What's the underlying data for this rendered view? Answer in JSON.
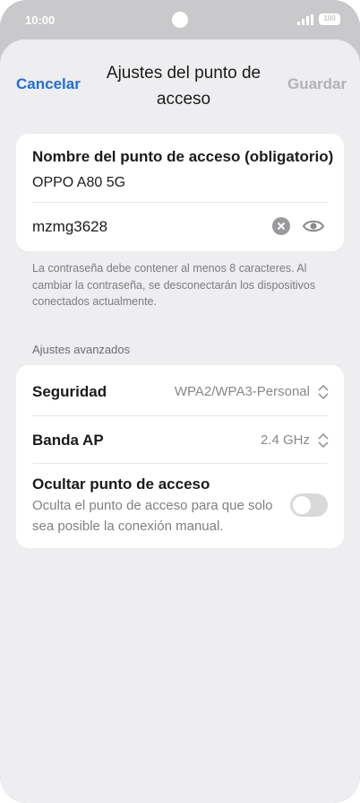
{
  "status_bar": {
    "time": "10:00",
    "battery": "100"
  },
  "nav": {
    "cancel_label": "Cancelar",
    "title": "Ajustes del punto de acceso",
    "save_label": "Guardar"
  },
  "hotspot": {
    "name_label": "Nombre del punto de acceso (obligatorio)",
    "name_value": "OPPO A80 5G",
    "password_value": "mzmg3628",
    "password_hint": "La contraseña debe contener al menos 8 caracteres. Al cambiar la contraseña, se desconectarán los dispositivos conectados actualmente."
  },
  "advanced": {
    "section_label": "Ajustes avanzados",
    "security_label": "Seguridad",
    "security_value": "WPA2/WPA3-Personal",
    "band_label": "Banda AP",
    "band_value": "2.4 GHz",
    "hide_label": "Ocultar punto de acceso",
    "hide_description": "Oculta el punto de acceso para que solo sea posible la conexión manual.",
    "hide_enabled": false
  },
  "colors": {
    "accent": "#1e6fd9",
    "disabled": "#b3b3b6",
    "background": "#eeeef0"
  }
}
